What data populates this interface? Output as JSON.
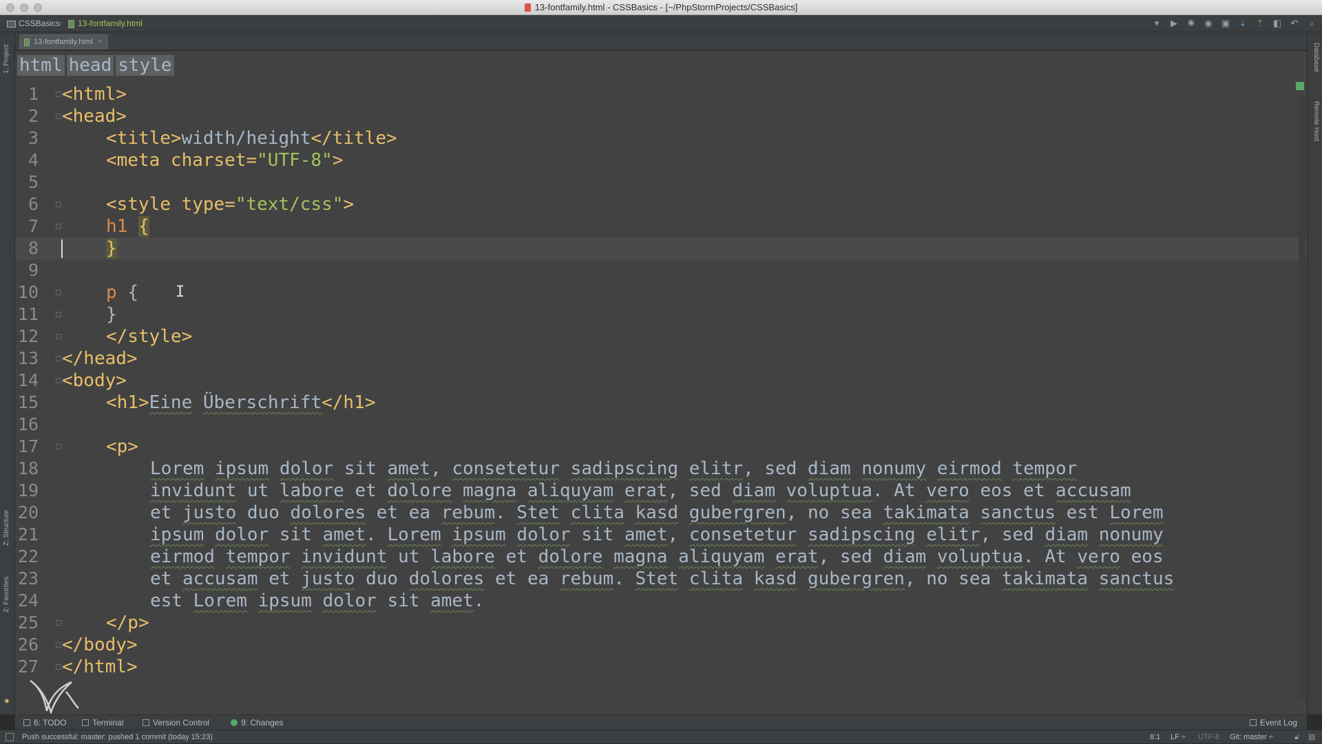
{
  "window": {
    "title": "13-fontfamily.html - CSSBasics - [~/PhpStormProjects/CSSBasics]"
  },
  "navbar": {
    "project": "CSSBasics",
    "file": "13-fontfamily.html"
  },
  "editor_tab": {
    "label": "13-fontfamily.html",
    "close": "×"
  },
  "breadcrumbs": [
    "html",
    "head",
    "style"
  ],
  "side_panels": {
    "project": "1: Project",
    "structure": "Z: Structure",
    "favorites": "2: Favorites",
    "database": "Database",
    "remote_host": "Remote Host"
  },
  "toolbar_icons": [
    "dropdown-icon",
    "run-icon",
    "debug-icon",
    "coverage-icon",
    "profile-icon",
    "vcs-update-icon",
    "vcs-commit-icon",
    "compare-icon",
    "revert-icon",
    "search-icon"
  ],
  "code": {
    "line_numbers": [
      "1",
      "2",
      "3",
      "4",
      "5",
      "6",
      "7",
      "8",
      "9",
      "10",
      "11",
      "12",
      "13",
      "14",
      "15",
      "16",
      "17",
      "18",
      "19",
      "20",
      "21",
      "22",
      "23",
      "24",
      "25",
      "26",
      "27"
    ],
    "l1": "<html>",
    "l2": "<head>",
    "l3": {
      "open": "<title>",
      "text": "width/height",
      "close": "</title>"
    },
    "l4": {
      "tag": "<meta charset=",
      "value": "\"UTF-8\"",
      "end": ">"
    },
    "l6": {
      "tag": "<style type=",
      "value": "\"text/css\"",
      "end": ">"
    },
    "l7": {
      "selector": "h1",
      "brace": "{"
    },
    "l8": {
      "brace": "}"
    },
    "l10": {
      "selector": "p",
      "brace": "{"
    },
    "l11": {
      "brace": "}"
    },
    "l12": "</style>",
    "l13": "</head>",
    "l14": "<body>",
    "l15": {
      "open": "<h1>",
      "w1": "Eine",
      "sp": " ",
      "w2": "Überschrift",
      "close": "</h1>"
    },
    "l17": "<p>",
    "l18": "Lorem ipsum dolor sit amet, consetetur sadipscing elitr, sed diam nonumy eirmod tempor",
    "l19": "invidunt ut labore et dolore magna aliquyam erat, sed diam voluptua. At vero eos et accusam",
    "l20": "et justo duo dolores et ea rebum. Stet clita kasd gubergren, no sea takimata sanctus est Lorem",
    "l21": "ipsum dolor sit amet. Lorem ipsum dolor sit amet, consetetur sadipscing elitr, sed diam nonumy",
    "l22": "eirmod tempor invidunt ut labore et dolore magna aliquyam erat, sed diam voluptua. At vero eos",
    "l23": "et accusam et justo duo dolores et ea rebum. Stet clita kasd gubergren, no sea takimata sanctus",
    "l24": "est Lorem ipsum dolor sit amet.",
    "l25": "</p>",
    "l26": "</body>",
    "l27": "</html>"
  },
  "bottom_tools": {
    "todo": "6: TODO",
    "terminal": "Terminal",
    "version_control": "Version Control",
    "changes": "9: Changes",
    "event_log": "Event Log"
  },
  "status": {
    "message": "Push successful: master: pushed 1 commit (today 15:23)",
    "position": "8:1",
    "line_sep": "LF ÷",
    "encoding": "UTF-8",
    "git": "Git: master ÷"
  },
  "colors": {
    "tag": "#e8bf6a",
    "text": "#a9b7c6",
    "string": "#a5c25c",
    "selector": "#d98b4b",
    "background": "#424242"
  }
}
